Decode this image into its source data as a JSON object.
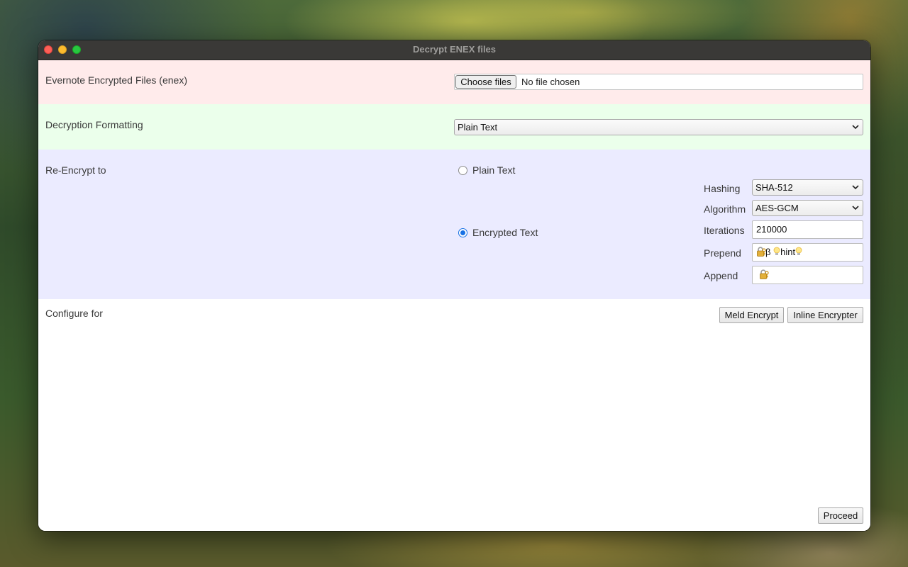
{
  "window": {
    "title": "Decrypt ENEX files"
  },
  "files": {
    "label": "Evernote Encrypted Files (enex)",
    "choose_button": "Choose files",
    "status": "No file chosen"
  },
  "formatting": {
    "label": "Decryption Formatting",
    "selected": "Plain Text"
  },
  "reencrypt": {
    "label": "Re-Encrypt to",
    "options": [
      {
        "label": "Plain Text",
        "checked": false
      },
      {
        "label": "Encrypted Text",
        "checked": true
      }
    ],
    "params": {
      "hashing": {
        "label": "Hashing",
        "value": "SHA-512"
      },
      "algorithm": {
        "label": "Algorithm",
        "value": "AES-GCM"
      },
      "iterations": {
        "label": "Iterations",
        "value": "210000"
      },
      "prepend": {
        "label": "Prepend",
        "value_beta": "β",
        "value_hint": "hint"
      },
      "append": {
        "label": "Append"
      }
    }
  },
  "configure": {
    "label": "Configure for",
    "buttons": [
      "Meld Encrypt",
      "Inline Encrypter"
    ]
  },
  "footer": {
    "proceed": "Proceed"
  },
  "colors": {
    "files_bg": "#ffebeb",
    "format_bg": "#ebffeb",
    "reencrypt_bg": "#ebebff",
    "accent": "#1670e4",
    "titlebar": "#3a3937"
  }
}
